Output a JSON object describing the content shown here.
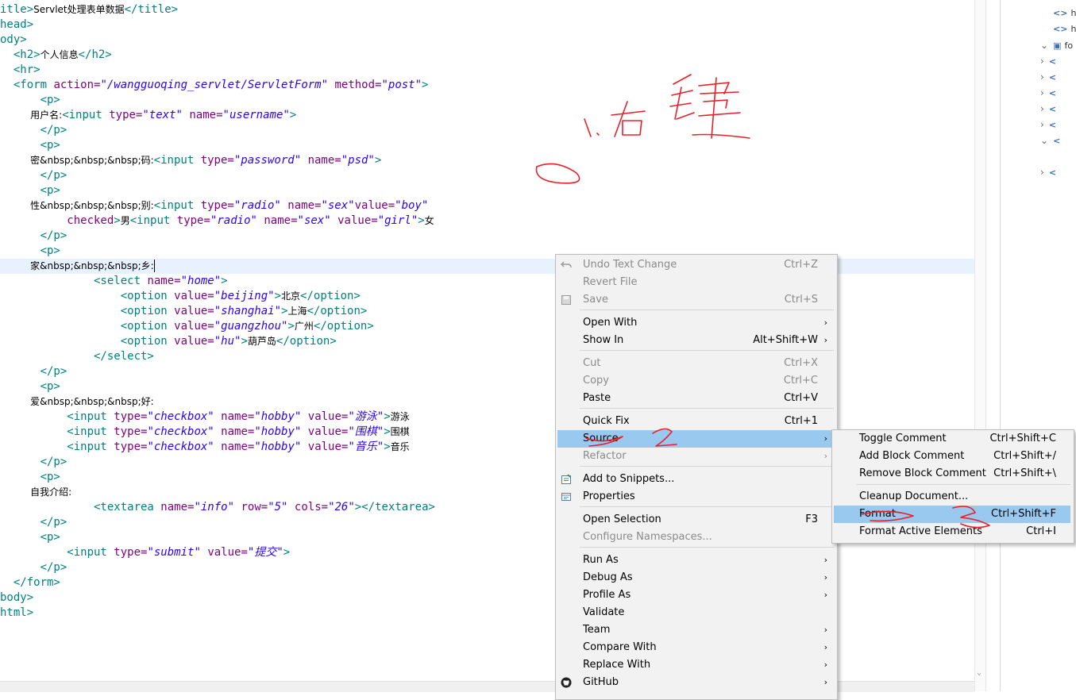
{
  "code_lines": [
    [
      [
        "t",
        "itle>"
      ],
      [
        "x",
        "Servlet处理表单数据"
      ],
      [
        "t",
        "</title>"
      ]
    ],
    [
      [
        "t",
        "head>"
      ]
    ],
    [
      [
        "t",
        "ody>"
      ]
    ],
    [
      [
        "t",
        "  <h2>"
      ],
      [
        "x",
        "个人信息"
      ],
      [
        "t",
        "</h2>"
      ]
    ],
    [
      [
        "t",
        "  <hr>"
      ]
    ],
    [
      [
        "t",
        "  <form "
      ],
      [
        "a",
        "action="
      ],
      [
        "v",
        "\"/wangguoqing_servlet/ServletForm\""
      ],
      [
        "a",
        " method="
      ],
      [
        "v",
        "\"post\""
      ],
      [
        "t",
        ">"
      ]
    ],
    [
      [
        "t",
        "      <p>"
      ]
    ],
    [
      [
        "x",
        "          用户名:"
      ],
      [
        "t",
        "<input "
      ],
      [
        "a",
        "type="
      ],
      [
        "v",
        "\"text\""
      ],
      [
        "a",
        " name="
      ],
      [
        "v",
        "\"username\""
      ],
      [
        "t",
        ">"
      ]
    ],
    [
      [
        "t",
        "      </p>"
      ]
    ],
    [
      [
        "t",
        "      <p>"
      ]
    ],
    [
      [
        "x",
        "          密&nbsp;&nbsp;&nbsp;码:"
      ],
      [
        "t",
        "<input "
      ],
      [
        "a",
        "type="
      ],
      [
        "v",
        "\"password\""
      ],
      [
        "a",
        " name="
      ],
      [
        "v",
        "\"psd\""
      ],
      [
        "t",
        ">"
      ]
    ],
    [
      [
        "t",
        "      </p>"
      ]
    ],
    [
      [
        "t",
        "      <p>"
      ]
    ],
    [
      [
        "x",
        "          性&nbsp;&nbsp;&nbsp;别:"
      ],
      [
        "t",
        "<input "
      ],
      [
        "a",
        "type="
      ],
      [
        "v",
        "\"radio\""
      ],
      [
        "a",
        " name="
      ],
      [
        "v",
        "\"sex\""
      ],
      [
        "a",
        "value="
      ],
      [
        "v",
        "\"boy\""
      ]
    ],
    [
      [
        "a",
        "          checked"
      ],
      [
        "t",
        ">"
      ],
      [
        "x",
        "男"
      ],
      [
        "t",
        "<input "
      ],
      [
        "a",
        "type="
      ],
      [
        "v",
        "\"radio\""
      ],
      [
        "a",
        " name="
      ],
      [
        "v",
        "\"sex\""
      ],
      [
        "a",
        " value="
      ],
      [
        "v",
        "\"girl\""
      ],
      [
        "t",
        ">"
      ],
      [
        "x",
        "女"
      ]
    ],
    [
      [
        "t",
        "      </p>"
      ]
    ],
    [
      [
        "t",
        "      <p>"
      ]
    ],
    [
      [
        "x",
        "          家&nbsp;&nbsp;&nbsp;乡:"
      ],
      [
        "caret",
        ""
      ]
    ],
    [
      [
        "t",
        "              <select "
      ],
      [
        "a",
        "name="
      ],
      [
        "v",
        "\"home\""
      ],
      [
        "t",
        ">"
      ]
    ],
    [
      [
        "t",
        "                  <option "
      ],
      [
        "a",
        "value="
      ],
      [
        "v",
        "\"beijing\""
      ],
      [
        "t",
        ">"
      ],
      [
        "x",
        "北京"
      ],
      [
        "t",
        "</option>"
      ]
    ],
    [
      [
        "t",
        "                  <option "
      ],
      [
        "a",
        "value="
      ],
      [
        "v",
        "\"shanghai\""
      ],
      [
        "t",
        ">"
      ],
      [
        "x",
        "上海"
      ],
      [
        "t",
        "</option>"
      ]
    ],
    [
      [
        "t",
        "                  <option "
      ],
      [
        "a",
        "value="
      ],
      [
        "v",
        "\"guangzhou\""
      ],
      [
        "t",
        ">"
      ],
      [
        "x",
        "广州"
      ],
      [
        "t",
        "</option>"
      ]
    ],
    [
      [
        "t",
        "                  <option "
      ],
      [
        "a",
        "value="
      ],
      [
        "v",
        "\"hu\""
      ],
      [
        "t",
        ">"
      ],
      [
        "x",
        "葫芦岛"
      ],
      [
        "t",
        "</option>"
      ]
    ],
    [
      [
        "t",
        "              </select>"
      ]
    ],
    [
      [
        "t",
        "      </p>"
      ]
    ],
    [
      [
        "t",
        "      <p>"
      ]
    ],
    [
      [
        "x",
        "          爱&nbsp;&nbsp;&nbsp;好:"
      ]
    ],
    [
      [
        "t",
        "          <input "
      ],
      [
        "a",
        "type="
      ],
      [
        "v",
        "\"checkbox\""
      ],
      [
        "a",
        " name="
      ],
      [
        "v",
        "\"hobby\""
      ],
      [
        "a",
        " value="
      ],
      [
        "v",
        "\"游泳\""
      ],
      [
        "t",
        ">"
      ],
      [
        "x",
        "游泳"
      ]
    ],
    [
      [
        "t",
        "          <input "
      ],
      [
        "a",
        "type="
      ],
      [
        "v",
        "\"checkbox\""
      ],
      [
        "a",
        " name="
      ],
      [
        "v",
        "\"hobby\""
      ],
      [
        "a",
        " value="
      ],
      [
        "v",
        "\"围棋\""
      ],
      [
        "t",
        ">"
      ],
      [
        "x",
        "围棋"
      ]
    ],
    [
      [
        "t",
        "          <input "
      ],
      [
        "a",
        "type="
      ],
      [
        "v",
        "\"checkbox\""
      ],
      [
        "a",
        " name="
      ],
      [
        "v",
        "\"hobby\""
      ],
      [
        "a",
        " value="
      ],
      [
        "v",
        "\"音乐\""
      ],
      [
        "t",
        ">"
      ],
      [
        "x",
        "音乐"
      ]
    ],
    [
      [
        "t",
        "      </p>"
      ]
    ],
    [
      [
        "t",
        "      <p>"
      ]
    ],
    [
      [
        "x",
        "          自我介绍:"
      ]
    ],
    [
      [
        "t",
        "              <textarea "
      ],
      [
        "a",
        "name="
      ],
      [
        "v",
        "\"info\""
      ],
      [
        "a",
        " row="
      ],
      [
        "v",
        "\"5\""
      ],
      [
        "a",
        " cols="
      ],
      [
        "v",
        "\"26\""
      ],
      [
        "t",
        "></textarea>"
      ]
    ],
    [
      [
        "t",
        "      </p>"
      ]
    ],
    [
      [
        "t",
        "      <p>"
      ]
    ],
    [
      [
        "t",
        "          <input "
      ],
      [
        "a",
        "type="
      ],
      [
        "v",
        "\"submit\""
      ],
      [
        "a",
        " value="
      ],
      [
        "v",
        "\"提交\""
      ],
      [
        "t",
        ">"
      ]
    ],
    [
      [
        "t",
        "      </p>"
      ]
    ],
    [
      [
        "t",
        "  </form>"
      ]
    ],
    [
      [
        "t",
        "body>"
      ]
    ],
    [
      [
        "t",
        "html>"
      ]
    ]
  ],
  "outline": [
    {
      "twisty": "",
      "icon": "<>",
      "label": "h"
    },
    {
      "twisty": "",
      "icon": "<>",
      "label": "h"
    },
    {
      "twisty": "⌄",
      "icon": "▣",
      "label": "fo"
    },
    {
      "twisty": "›",
      "icon": "<",
      "label": ""
    },
    {
      "twisty": "›",
      "icon": "<",
      "label": ""
    },
    {
      "twisty": "›",
      "icon": "<",
      "label": ""
    },
    {
      "twisty": "›",
      "icon": "<",
      "label": ""
    },
    {
      "twisty": "›",
      "icon": "<",
      "label": ""
    },
    {
      "twisty": "⌄",
      "icon": "<",
      "label": ""
    },
    {
      "twisty": "›",
      "icon": "<",
      "label": ""
    }
  ],
  "context_menu": {
    "items": [
      {
        "label": "Undo Text Change",
        "shortcut": "Ctrl+Z",
        "disabled": true,
        "icon": "undo-icon"
      },
      {
        "label": "Revert File",
        "shortcut": "",
        "disabled": true
      },
      {
        "label": "Save",
        "shortcut": "Ctrl+S",
        "disabled": true,
        "icon": "save-icon"
      },
      {
        "label": "Open With",
        "shortcut": "",
        "submenu": true
      },
      {
        "label": "Show In",
        "shortcut": "Alt+Shift+W",
        "submenu": true
      },
      {
        "label": "Cut",
        "shortcut": "Ctrl+X",
        "disabled": true
      },
      {
        "label": "Copy",
        "shortcut": "Ctrl+C",
        "disabled": true
      },
      {
        "label": "Paste",
        "shortcut": "Ctrl+V"
      },
      {
        "label": "Quick Fix",
        "shortcut": "Ctrl+1"
      },
      {
        "label": "Source",
        "shortcut": "",
        "submenu": true,
        "selected": true
      },
      {
        "label": "Refactor",
        "shortcut": "",
        "submenu": true,
        "disabled": true
      },
      {
        "label": "Add to Snippets...",
        "shortcut": "",
        "icon": "snippets-icon"
      },
      {
        "label": "Properties",
        "shortcut": "",
        "icon": "properties-icon"
      },
      {
        "label": "Open Selection",
        "shortcut": "F3"
      },
      {
        "label": "Configure Namespaces...",
        "shortcut": "",
        "disabled": true
      },
      {
        "label": "Run As",
        "shortcut": "",
        "submenu": true
      },
      {
        "label": "Debug As",
        "shortcut": "",
        "submenu": true
      },
      {
        "label": "Profile As",
        "shortcut": "",
        "submenu": true
      },
      {
        "label": "Validate",
        "shortcut": ""
      },
      {
        "label": "Team",
        "shortcut": "",
        "submenu": true
      },
      {
        "label": "Compare With",
        "shortcut": "",
        "submenu": true
      },
      {
        "label": "Replace With",
        "shortcut": "",
        "submenu": true
      },
      {
        "label": "GitHub",
        "shortcut": "",
        "submenu": true,
        "icon": "github-icon"
      }
    ]
  },
  "source_submenu": {
    "items": [
      {
        "label": "Toggle Comment",
        "shortcut": "Ctrl+Shift+C"
      },
      {
        "label": "Add Block Comment",
        "shortcut": "Ctrl+Shift+/"
      },
      {
        "label": "Remove Block Comment",
        "shortcut": "Ctrl+Shift+\\"
      },
      {
        "label": "Cleanup Document...",
        "shortcut": ""
      },
      {
        "label": "Format",
        "shortcut": "Ctrl+Shift+F",
        "selected": true
      },
      {
        "label": "Format Active Elements",
        "shortcut": "Ctrl+I"
      }
    ]
  },
  "colors": {
    "tag": "#008080",
    "attribute": "#7f007f",
    "value": "#2a00ff",
    "selection": "#99c9ef",
    "current_line": "#e8f2fe",
    "annotation": "#e8202a"
  }
}
